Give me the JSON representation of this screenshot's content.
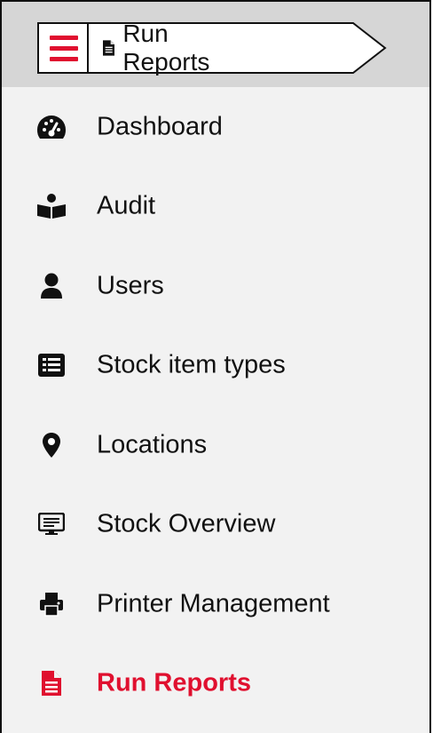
{
  "header": {
    "breadcrumb_label": "Run Reports",
    "menu_icon": "hamburger-menu-icon",
    "breadcrumb_icon": "file-text-icon"
  },
  "nav": {
    "items": [
      {
        "label": "Dashboard",
        "icon": "tachometer-icon"
      },
      {
        "label": "Audit",
        "icon": "audit-book-icon"
      },
      {
        "label": "Users",
        "icon": "user-icon"
      },
      {
        "label": "Stock item types",
        "icon": "list-alt-icon"
      },
      {
        "label": "Locations",
        "icon": "map-marker-icon"
      },
      {
        "label": "Stock Overview",
        "icon": "monitor-icon"
      },
      {
        "label": "Printer Management",
        "icon": "print-icon"
      },
      {
        "label": "Run Reports",
        "icon": "file-report-icon",
        "active": true
      }
    ]
  },
  "colors": {
    "accent": "#e0102f",
    "header_bg": "#d6d6d6",
    "panel_bg": "#f2f2f2"
  }
}
